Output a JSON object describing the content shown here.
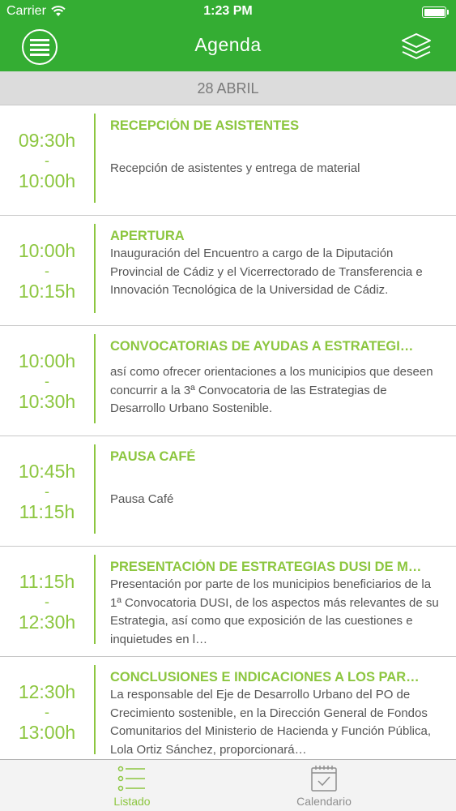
{
  "status": {
    "carrier": "Carrier",
    "time": "1:23 PM"
  },
  "nav": {
    "title": "Agenda",
    "left_icon": "menu-list-icon",
    "right_icon": "layers-icon"
  },
  "date_header": "28 ABRIL",
  "items": [
    {
      "start": "09:30h",
      "sep": "-",
      "end": "10:00h",
      "title": "RECEPCIÓN DE ASISTENTES",
      "description": "Recepción de asistentes y entrega de material"
    },
    {
      "start": "10:00h",
      "sep": "-",
      "end": "10:15h",
      "title": "APERTURA",
      "description": "Inauguración del Encuentro a cargo de la Diputación Provincial de Cádiz y el Vicerrectorado de Transferencia e Innovación Tecnológica de la Universidad de Cádiz."
    },
    {
      "start": "10:00h",
      "sep": "-",
      "end": "10:30h",
      "title": "CONVOCATORIAS DE AYUDAS A ESTRATEGI…",
      "description": "así como ofrecer orientaciones a los municipios que deseen concurrir a la 3ª Convocatoria de las Estrategias de Desarrollo Urbano Sostenible."
    },
    {
      "start": "10:45h",
      "sep": "-",
      "end": "11:15h",
      "title": "PAUSA CAFÉ",
      "description": "Pausa Café"
    },
    {
      "start": "11:15h",
      "sep": "-",
      "end": "12:30h",
      "title": "PRESENTACIÓN DE ESTRATEGIAS DUSI DE M…",
      "description": "Presentación por parte de los municipios beneficiarios de la 1ª Convocatoria DUSI, de los aspectos más relevantes de su Estrategia, así como que exposición de las cuestiones e inquietudes en l…"
    },
    {
      "start": "12:30h",
      "sep": "-",
      "end": "13:00h",
      "title": "CONCLUSIONES E INDICACIONES A LOS PAR…",
      "description": "La responsable del Eje de Desarrollo Urbano del PO de Crecimiento sostenible, en la Dirección General de Fondos Comunitarios del Ministerio de Hacienda y Función Pública, Lola Ortiz Sánchez, proporcionará…"
    }
  ],
  "tabs": [
    {
      "label": "Listado",
      "icon": "list-icon",
      "active": true
    },
    {
      "label": "Calendario",
      "icon": "calendar-icon",
      "active": false
    }
  ],
  "colors": {
    "header_green": "#34ad33",
    "accent_green": "#8cc63f",
    "inactive_gray": "#8e8e8e"
  }
}
